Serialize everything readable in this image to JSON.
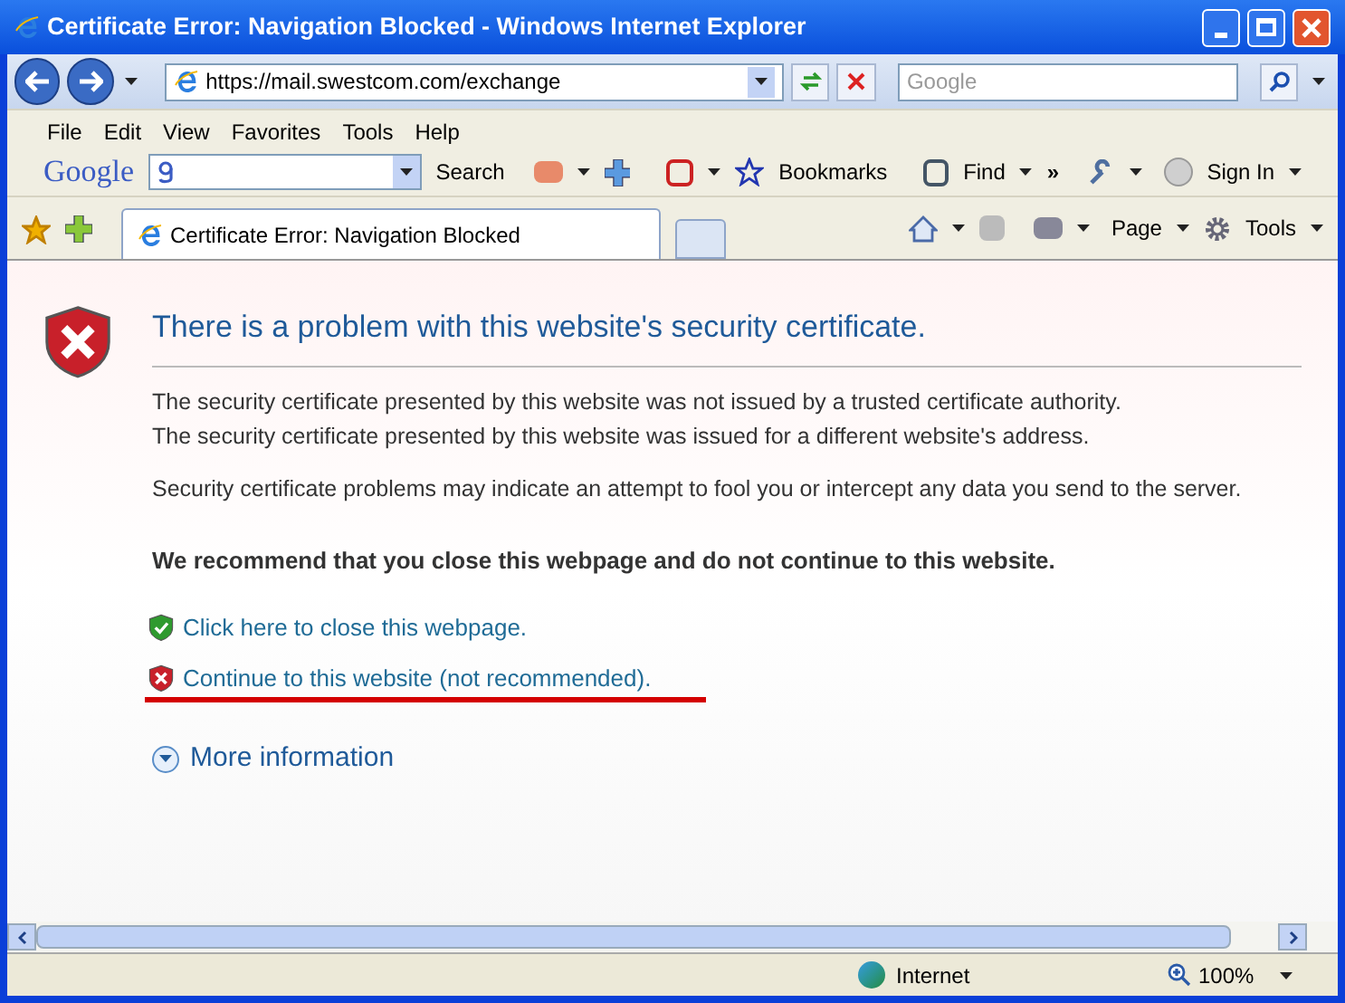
{
  "window": {
    "title": "Certificate Error: Navigation Blocked - Windows Internet Explorer"
  },
  "address": {
    "url": "https://mail.swestcom.com/exchange"
  },
  "search": {
    "placeholder": "Google"
  },
  "menu": [
    "File",
    "Edit",
    "View",
    "Favorites",
    "Tools",
    "Help"
  ],
  "google_toolbar": {
    "logo": "Google",
    "search_label": "Search",
    "bookmarks": "Bookmarks",
    "find": "Find",
    "more": "»",
    "sign_in": "Sign In"
  },
  "tab": {
    "title": "Certificate Error: Navigation Blocked",
    "selected": true
  },
  "command_bar": {
    "page": "Page",
    "tools": "Tools"
  },
  "content": {
    "heading": "There is a problem with this website's security certificate.",
    "paragraphs": [
      "The security certificate presented by this website was not issued by a trusted certificate authority.\nThe security certificate presented by this website was issued for a different website's address.",
      "Security certificate problems may indicate an attempt to fool you or intercept any data you send to the server."
    ],
    "recommendation": "We recommend that you close this webpage and do not continue to this website.",
    "links": [
      {
        "kind": "safe",
        "text": "Click here to close this webpage."
      },
      {
        "kind": "danger",
        "text": "Continue to this website (not recommended)."
      }
    ],
    "more_info": "More information"
  },
  "status_bar": {
    "zone": "Internet",
    "zoom": "100%"
  }
}
